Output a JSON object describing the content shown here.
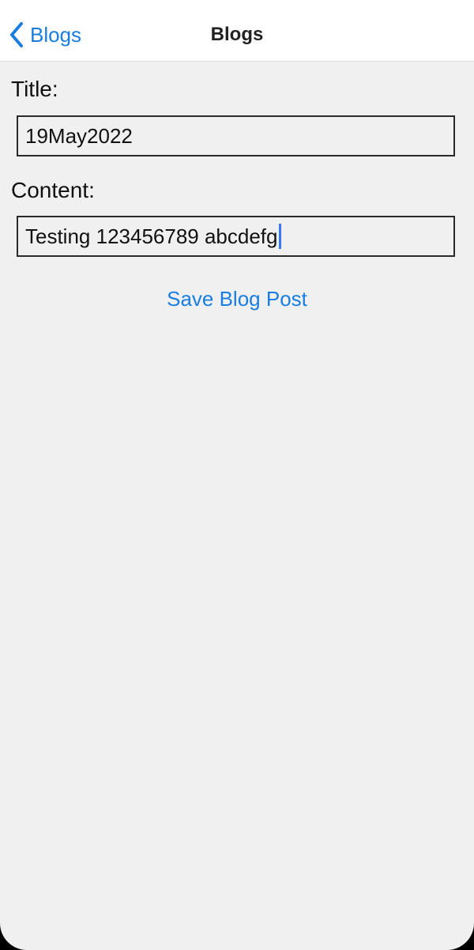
{
  "colors": {
    "accent": "#1a7de0",
    "background": "#f0f0f0",
    "caret": "#3478f6"
  },
  "navbar": {
    "back_label": "Blogs",
    "back_icon": "chevron-left-icon",
    "title": "Blogs"
  },
  "form": {
    "title_label": "Title:",
    "title_value": "19May2022",
    "content_label": "Content:",
    "content_value": "Testing 123456789 abcdefg",
    "save_label": "Save Blog Post"
  }
}
